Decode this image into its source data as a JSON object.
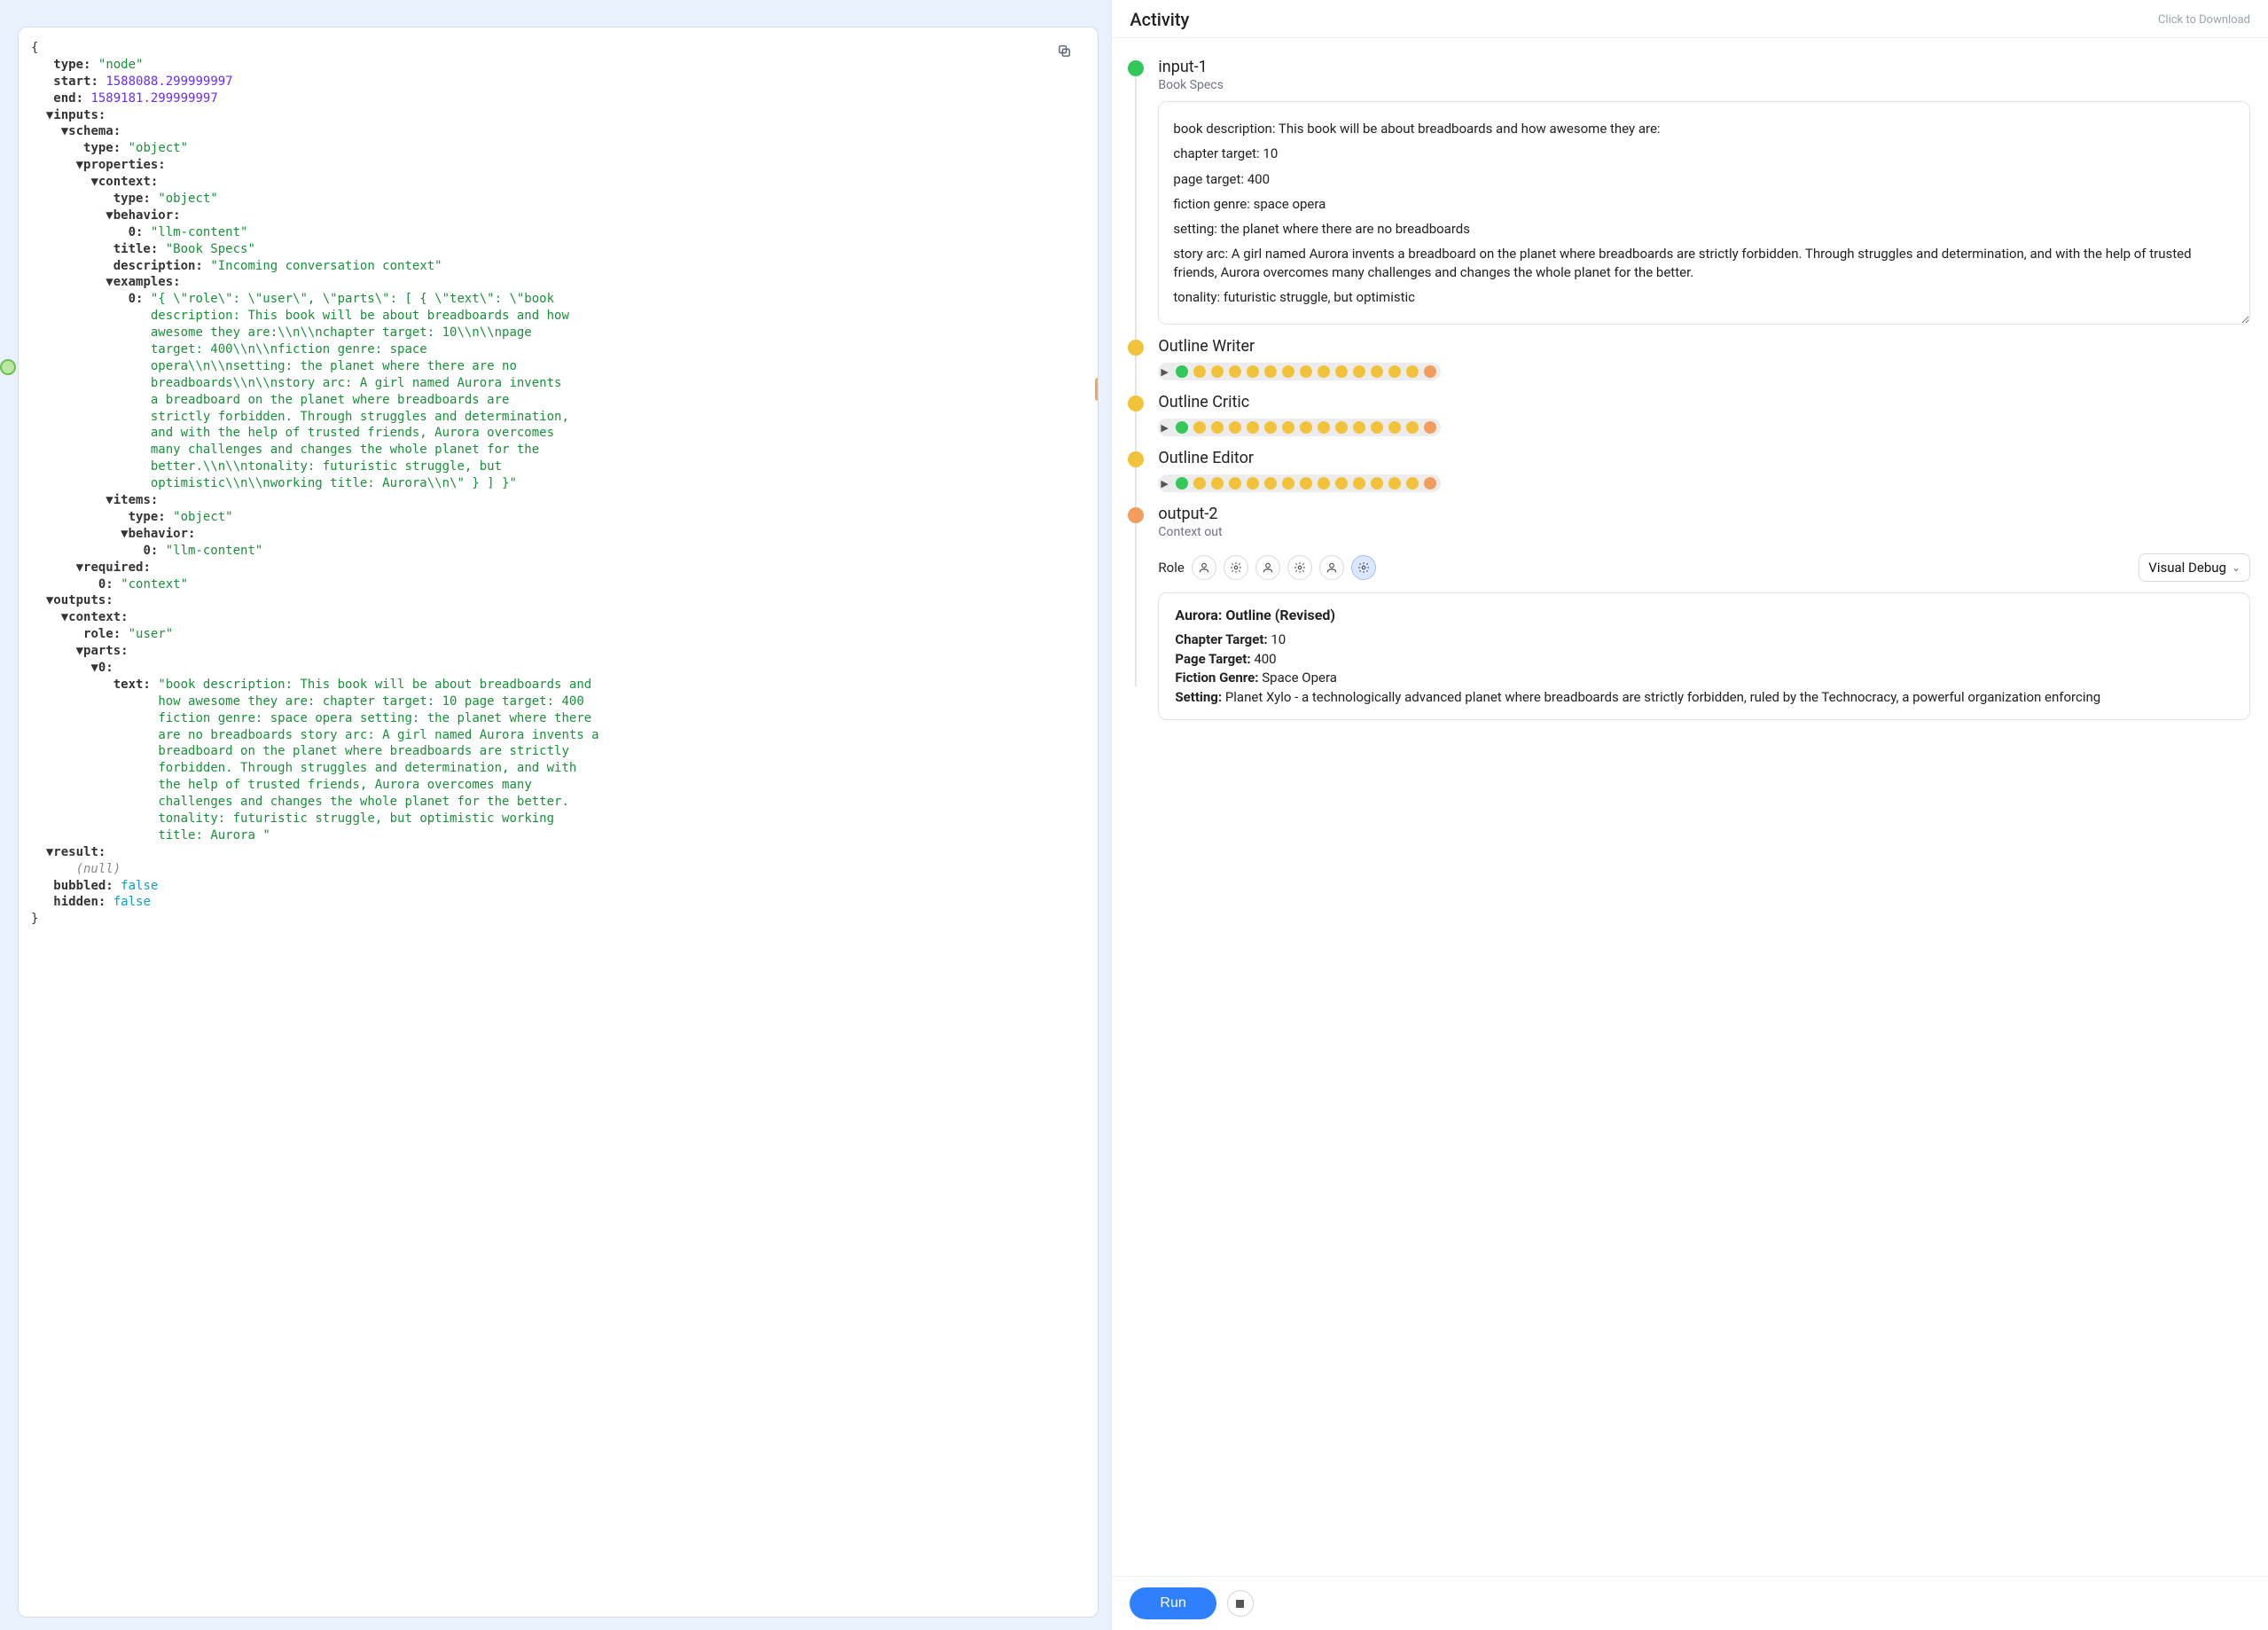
{
  "activity": {
    "title": "Activity",
    "download_hint": "Click to Download",
    "run_label": "Run",
    "visual_debug_label": "Visual Debug",
    "role_label": "Role"
  },
  "steps": {
    "input": {
      "title": "input-1",
      "subtitle": "Book Specs",
      "spec_lines": [
        "book description: This book will be about breadboards and how awesome they are:",
        "chapter target: 10",
        "page target: 400",
        "fiction genre: space opera",
        "setting: the planet where there are no breadboards",
        "story arc: A girl named Aurora invents a breadboard on the planet where breadboards are strictly forbidden. Through struggles and determination, and with the help of trusted friends, Aurora overcomes many challenges and changes the whole planet for the better.",
        "tonality: futuristic struggle, but optimistic"
      ]
    },
    "outline_writer": {
      "title": "Outline Writer"
    },
    "outline_critic": {
      "title": "Outline Critic"
    },
    "outline_editor": {
      "title": "Outline Editor"
    },
    "output": {
      "title": "output-2",
      "subtitle": "Context out",
      "doc_title": "Aurora: Outline (Revised)",
      "chapter_target_label": "Chapter Target:",
      "chapter_target_value": "10",
      "page_target_label": "Page Target:",
      "page_target_value": "400",
      "genre_label": "Fiction Genre:",
      "genre_value": "Space Opera",
      "setting_label": "Setting:",
      "setting_value": "Planet Xylo - a technologically advanced planet where breadboards are strictly forbidden, ruled by the Technocracy, a powerful organization enforcing"
    }
  },
  "json_tree": {
    "type_key": "type:",
    "type_val": "\"node\"",
    "start_key": "start:",
    "start_val": "1588088.299999997",
    "end_key": "end:",
    "end_val": "1589181.299999997",
    "inputs_key": "inputs:",
    "schema_key": "schema:",
    "schema_type_key": "type:",
    "schema_type_val": "\"object\"",
    "properties_key": "properties:",
    "context_key": "context:",
    "context_type_key": "type:",
    "context_type_val": "\"object\"",
    "behavior_key": "behavior:",
    "behavior_0_key": "0:",
    "behavior_0_val": "\"llm-content\"",
    "title_key": "title:",
    "title_val": "\"Book Specs\"",
    "description_key": "description:",
    "description_val": "\"Incoming conversation context\"",
    "examples_key": "examples:",
    "examples_0_key": "0:",
    "examples_0_val": "\"{ \\\"role\\\": \\\"user\\\", \\\"parts\\\": [ { \\\"text\\\": \\\"book description: This book will be about breadboards and how awesome they are:\\\\n\\\\nchapter target: 10\\\\n\\\\npage target: 400\\\\n\\\\nfiction genre: space opera\\\\n\\\\nsetting: the planet where there are no breadboards\\\\n\\\\nstory arc: A girl named Aurora invents a breadboard on the planet where breadboards are strictly forbidden. Through struggles and determination, and with the help of trusted friends, Aurora overcomes many challenges and changes the whole planet for the better.\\\\n\\\\ntonality: futuristic struggle, but optimistic\\\\n\\\\nworking title: Aurora\\\\n\\\" } ] }\"",
    "items_key": "items:",
    "items_type_key": "type:",
    "items_type_val": "\"object\"",
    "items_behavior_key": "behavior:",
    "items_behavior_0_key": "0:",
    "items_behavior_0_val": "\"llm-content\"",
    "required_key": "required:",
    "required_0_key": "0:",
    "required_0_val": "\"context\"",
    "outputs_key": "outputs:",
    "out_context_key": "context:",
    "role_key": "role:",
    "role_val": "\"user\"",
    "parts_key": "parts:",
    "parts_0_key": "0:",
    "text_key": "text:",
    "text_val": "\"book description: This book will be about breadboards and how awesome they are: chapter target: 10 page target: 400 fiction genre: space opera setting: the planet where there are no breadboards story arc: A girl named Aurora invents a breadboard on the planet where breadboards are strictly forbidden. Through struggles and determination, and with the help of trusted friends, Aurora overcomes many challenges and changes the whole planet for the better. tonality: futuristic struggle, but optimistic working title: Aurora \"",
    "result_key": "result:",
    "result_val": "(null)",
    "bubbled_key": "bubbled:",
    "bubbled_val": "false",
    "hidden_key": "hidden:",
    "hidden_val": "false"
  }
}
